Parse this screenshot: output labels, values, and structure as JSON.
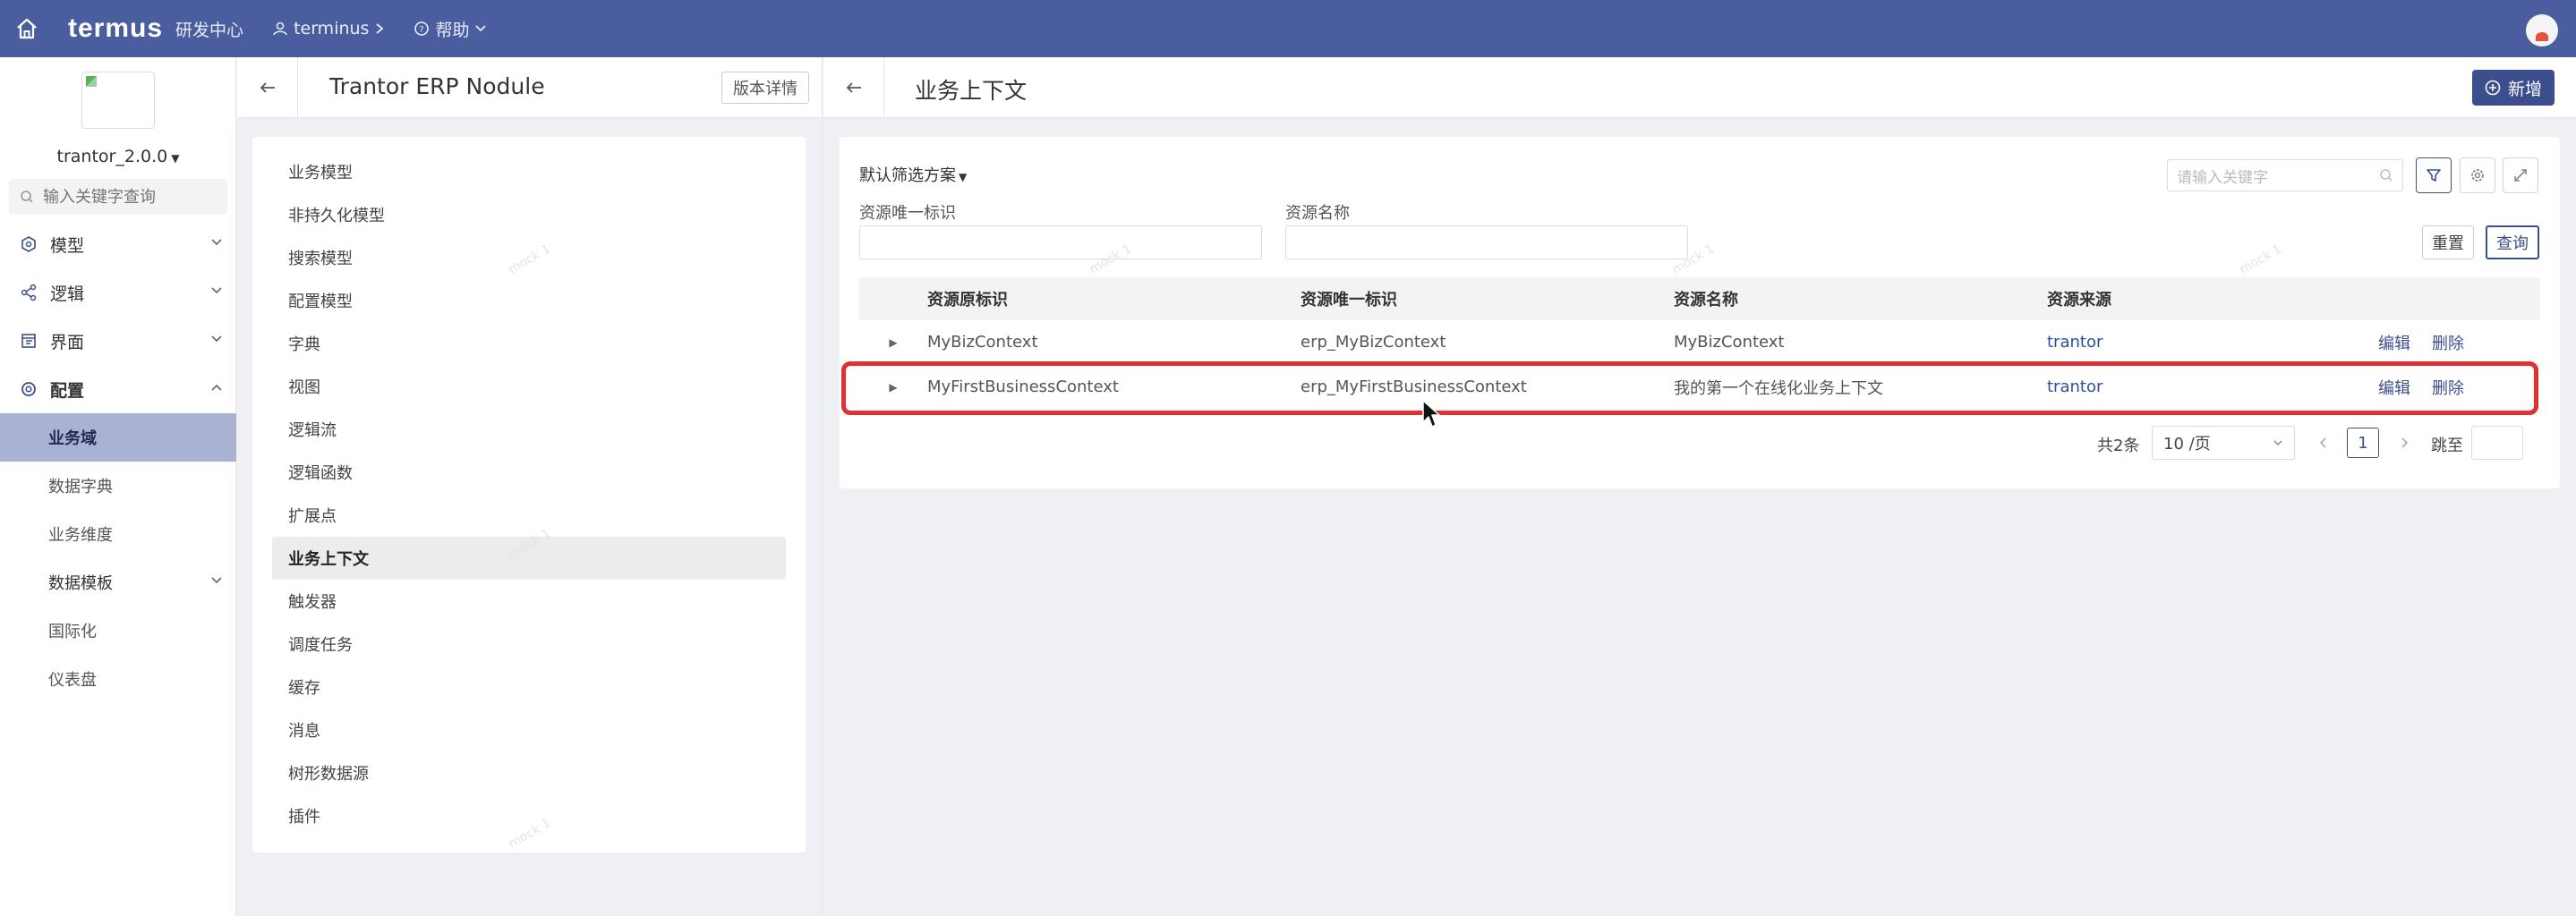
{
  "topbar": {
    "logo": "termus",
    "org": "研发中心",
    "user": "terminus",
    "help": "帮助"
  },
  "sidebar": {
    "version": "trantor_2.0.0",
    "search_placeholder": "输入关键字查询",
    "groups": [
      {
        "label": "模型",
        "icon": "model-icon"
      },
      {
        "label": "逻辑",
        "icon": "logic-icon"
      },
      {
        "label": "界面",
        "icon": "ui-icon"
      },
      {
        "label": "配置",
        "icon": "config-icon"
      }
    ],
    "subitems": [
      {
        "label": "业务域"
      },
      {
        "label": "数据字典"
      },
      {
        "label": "业务维度"
      },
      {
        "label": "数据模板"
      },
      {
        "label": "国际化"
      },
      {
        "label": "仪表盘"
      }
    ]
  },
  "middle": {
    "title": "Trantor ERP Nodule",
    "version_button": "版本详情",
    "items": [
      {
        "label": "业务模型"
      },
      {
        "label": "非持久化模型"
      },
      {
        "label": "搜索模型"
      },
      {
        "label": "配置模型"
      },
      {
        "label": "字典"
      },
      {
        "label": "视图"
      },
      {
        "label": "逻辑流"
      },
      {
        "label": "逻辑函数"
      },
      {
        "label": "扩展点"
      },
      {
        "label": "业务上下文"
      },
      {
        "label": "触发器"
      },
      {
        "label": "调度任务"
      },
      {
        "label": "缓存"
      },
      {
        "label": "消息"
      },
      {
        "label": "树形数据源"
      },
      {
        "label": "插件"
      }
    ]
  },
  "right": {
    "title": "业务上下文",
    "add_button": "新增",
    "filter_scheme": "默认筛选方案",
    "keyword_placeholder": "请输入关键字",
    "filter_unique_label": "资源唯一标识",
    "filter_name_label": "资源名称",
    "reset": "重置",
    "query": "查询",
    "columns": [
      "资源原标识",
      "资源唯一标识",
      "资源名称",
      "资源来源"
    ],
    "rows": [
      {
        "orig": "MyBizContext",
        "unique": "erp_MyBizContext",
        "name": "MyBizContext",
        "source": "trantor",
        "edit": "编辑",
        "delete": "删除"
      },
      {
        "orig": "MyFirstBusinessContext",
        "unique": "erp_MyFirstBusinessContext",
        "name": "我的第一个在线化业务上下文",
        "source": "trantor",
        "edit": "编辑",
        "delete": "删除"
      }
    ],
    "pagination": {
      "total": "共2条",
      "page_size": "10 /页",
      "current": "1",
      "jump": "跳至"
    }
  },
  "watermark": "mock 1",
  "colors": {
    "topbar": "#4a5d9e",
    "primary": "#3d4e8f",
    "highlight": "#e03030",
    "active_menu": "#a9b2d2"
  }
}
